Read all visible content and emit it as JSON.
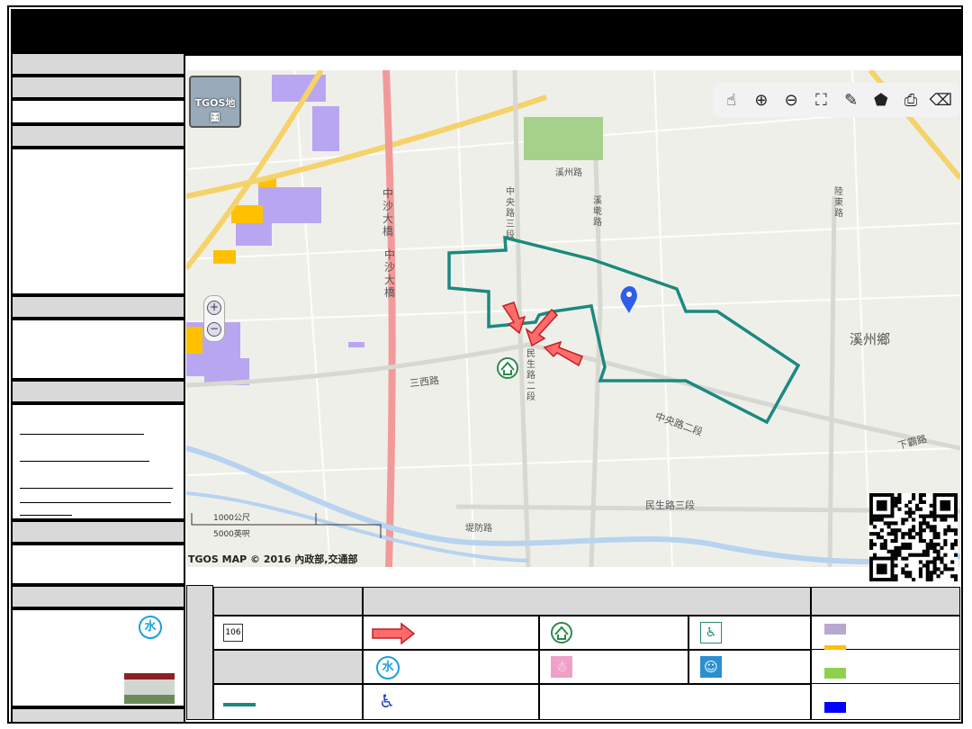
{
  "map": {
    "logo_label": "TGOS地圖",
    "copyright": "TGOS MAP © 2016 內政部,交通部",
    "scale_km": "1000公尺",
    "scale_ft": "5000英呎",
    "zoom_in": "+",
    "zoom_out": "−",
    "place_labels": {
      "township": "溪州鄉",
      "bridge1": "中沙大橋",
      "bridge2": "中沙大橋",
      "road_sanxi": "三西路",
      "road_minsheng2": "民生路二段",
      "road_zhongyang2": "中央路二段",
      "road_zhongyang3": "中央路三段",
      "road_minsheng": "民生路三段",
      "road_xizhou": "溪州路",
      "road_xishan": "溪墘路",
      "road_xiaba": "下霸路",
      "road_luhu": "陸東路",
      "road_dikang": "堤防路"
    },
    "tools": [
      "pan-icon",
      "zoom-in-icon",
      "zoom-out-icon",
      "full-extent-icon",
      "measure-icon",
      "polygon-icon",
      "print-icon",
      "eraser-icon"
    ]
  },
  "legend": {
    "route_number": "106",
    "badge_glyph": "水",
    "colors": {
      "boundary": "#1a8a80",
      "arrow": "#e03030",
      "purple": "#b9a6d1",
      "orange": "#ffc000",
      "green": "#8fd14f",
      "blue": "#0000ff"
    }
  },
  "sidebar": {
    "badge_glyph": "水"
  }
}
